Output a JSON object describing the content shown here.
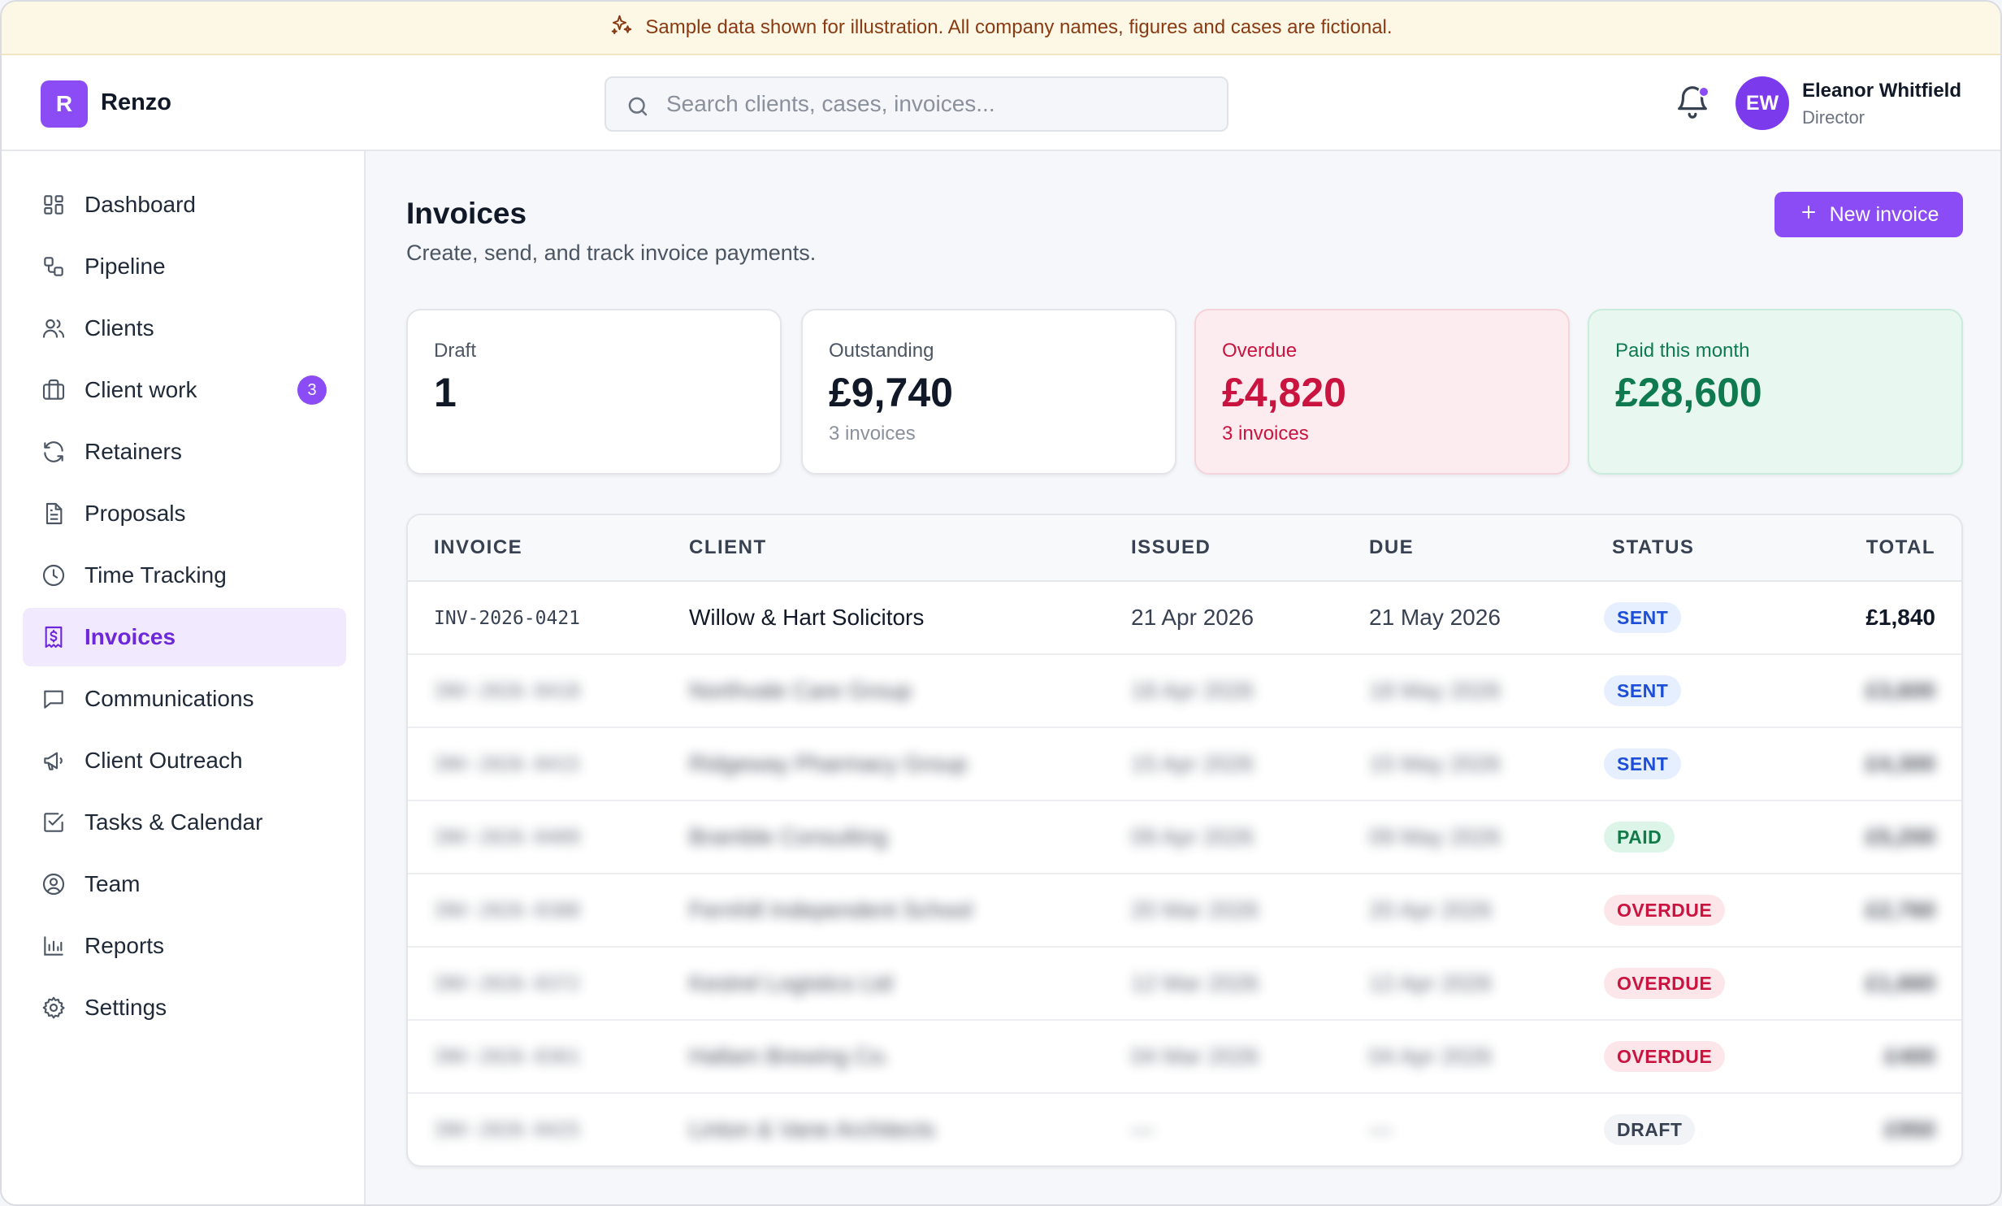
{
  "banner": {
    "text": "Sample data shown for illustration. All company names, figures and cases are fictional."
  },
  "header": {
    "logo_letter": "R",
    "brand": "Renzo",
    "search_placeholder": "Search clients, cases, invoices...",
    "user": {
      "initials": "EW",
      "name": "Eleanor Whitfield",
      "role": "Director"
    }
  },
  "sidebar": {
    "items": [
      {
        "label": "Dashboard",
        "icon": "dashboard-icon"
      },
      {
        "label": "Pipeline",
        "icon": "pipeline-icon"
      },
      {
        "label": "Clients",
        "icon": "users-icon"
      },
      {
        "label": "Client work",
        "icon": "briefcase-icon",
        "badge": "3"
      },
      {
        "label": "Retainers",
        "icon": "refresh-icon"
      },
      {
        "label": "Proposals",
        "icon": "document-icon"
      },
      {
        "label": "Time Tracking",
        "icon": "clock-icon"
      },
      {
        "label": "Invoices",
        "icon": "invoice-icon",
        "active": true
      },
      {
        "label": "Communications",
        "icon": "chat-icon"
      },
      {
        "label": "Client Outreach",
        "icon": "megaphone-icon"
      },
      {
        "label": "Tasks & Calendar",
        "icon": "checkbox-icon"
      },
      {
        "label": "Team",
        "icon": "user-circle-icon"
      },
      {
        "label": "Reports",
        "icon": "bar-chart-icon"
      },
      {
        "label": "Settings",
        "icon": "gear-icon"
      }
    ]
  },
  "main": {
    "title": "Invoices",
    "subtitle": "Create, send, and track invoice payments.",
    "new_button": "New invoice",
    "stats": [
      {
        "label": "Draft",
        "value": "1",
        "note": ""
      },
      {
        "label": "Outstanding",
        "value": "£9,740",
        "note": "3 invoices"
      },
      {
        "label": "Overdue",
        "value": "£4,820",
        "note": "3 invoices"
      },
      {
        "label": "Paid this month",
        "value": "£28,600",
        "note": ""
      }
    ],
    "table": {
      "headers": [
        "INVOICE",
        "CLIENT",
        "ISSUED",
        "DUE",
        "STATUS",
        "TOTAL"
      ],
      "rows": [
        {
          "invoice": "INV-2026-0421",
          "client": "Willow & Hart Solicitors",
          "issued": "21 Apr 2026",
          "due": "21 May 2026",
          "status": "SENT",
          "status_kind": "sent",
          "total": "£1,840",
          "blurred": false
        },
        {
          "invoice": "INV-2026-0418",
          "client": "Northvale Care Group",
          "issued": "18 Apr 2026",
          "due": "18 May 2026",
          "status": "SENT",
          "status_kind": "sent",
          "total": "£3,600",
          "blurred": true
        },
        {
          "invoice": "INV-2026-0415",
          "client": "Ridgeway Pharmacy Group",
          "issued": "15 Apr 2026",
          "due": "15 May 2026",
          "status": "SENT",
          "status_kind": "sent",
          "total": "£4,300",
          "blurred": true
        },
        {
          "invoice": "INV-2026-0409",
          "client": "Bramble Consulting",
          "issued": "09 Apr 2026",
          "due": "09 May 2026",
          "status": "PAID",
          "status_kind": "paid",
          "total": "£5,200",
          "blurred": true
        },
        {
          "invoice": "INV-2026-0388",
          "client": "Fernhill Independent School",
          "issued": "20 Mar 2026",
          "due": "20 Apr 2026",
          "status": "OVERDUE",
          "status_kind": "overdue",
          "total": "£2,760",
          "blurred": true
        },
        {
          "invoice": "INV-2026-0372",
          "client": "Kestrel Logistics Ltd",
          "issued": "12 Mar 2026",
          "due": "12 Apr 2026",
          "status": "OVERDUE",
          "status_kind": "overdue",
          "total": "£1,660",
          "blurred": true
        },
        {
          "invoice": "INV-2026-0361",
          "client": "Hallam Brewing Co.",
          "issued": "04 Mar 2026",
          "due": "04 Apr 2026",
          "status": "OVERDUE",
          "status_kind": "overdue",
          "total": "£400",
          "blurred": true
        },
        {
          "invoice": "INV-2026-0425",
          "client": "Linton & Vane Architects",
          "issued": "—",
          "due": "—",
          "status": "DRAFT",
          "status_kind": "draft",
          "total": "£950",
          "blurred": true
        }
      ]
    }
  },
  "colors": {
    "accent": "#8b4cf6",
    "overdue": "#c8143f",
    "paid": "#0f7a4f",
    "sent": "#1d4ed8"
  }
}
